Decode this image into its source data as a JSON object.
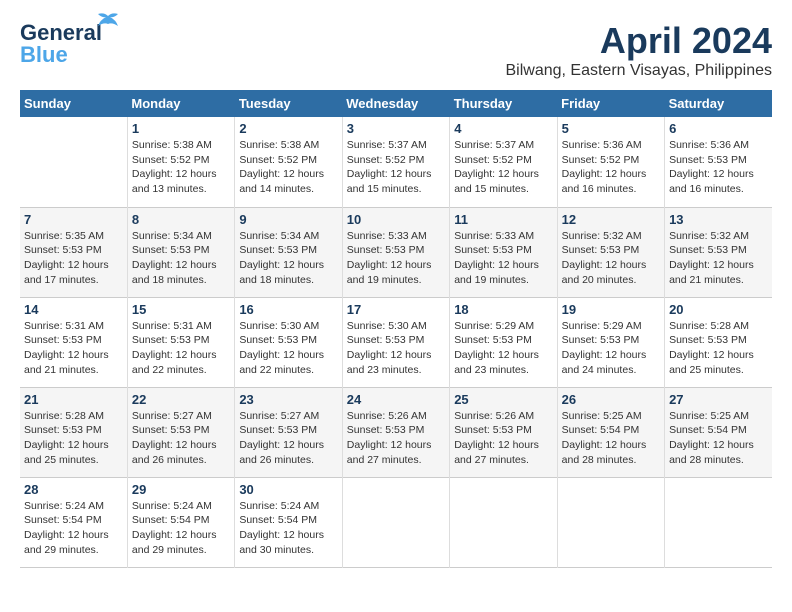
{
  "header": {
    "logo_line1": "General",
    "logo_line2": "Blue",
    "month_year": "April 2024",
    "location": "Bilwang, Eastern Visayas, Philippines"
  },
  "weekdays": [
    "Sunday",
    "Monday",
    "Tuesday",
    "Wednesday",
    "Thursday",
    "Friday",
    "Saturday"
  ],
  "weeks": [
    [
      {
        "day": "",
        "sunrise": "",
        "sunset": "",
        "daylight": ""
      },
      {
        "day": "1",
        "sunrise": "Sunrise: 5:38 AM",
        "sunset": "Sunset: 5:52 PM",
        "daylight": "Daylight: 12 hours and 13 minutes."
      },
      {
        "day": "2",
        "sunrise": "Sunrise: 5:38 AM",
        "sunset": "Sunset: 5:52 PM",
        "daylight": "Daylight: 12 hours and 14 minutes."
      },
      {
        "day": "3",
        "sunrise": "Sunrise: 5:37 AM",
        "sunset": "Sunset: 5:52 PM",
        "daylight": "Daylight: 12 hours and 15 minutes."
      },
      {
        "day": "4",
        "sunrise": "Sunrise: 5:37 AM",
        "sunset": "Sunset: 5:52 PM",
        "daylight": "Daylight: 12 hours and 15 minutes."
      },
      {
        "day": "5",
        "sunrise": "Sunrise: 5:36 AM",
        "sunset": "Sunset: 5:52 PM",
        "daylight": "Daylight: 12 hours and 16 minutes."
      },
      {
        "day": "6",
        "sunrise": "Sunrise: 5:36 AM",
        "sunset": "Sunset: 5:53 PM",
        "daylight": "Daylight: 12 hours and 16 minutes."
      }
    ],
    [
      {
        "day": "7",
        "sunrise": "Sunrise: 5:35 AM",
        "sunset": "Sunset: 5:53 PM",
        "daylight": "Daylight: 12 hours and 17 minutes."
      },
      {
        "day": "8",
        "sunrise": "Sunrise: 5:34 AM",
        "sunset": "Sunset: 5:53 PM",
        "daylight": "Daylight: 12 hours and 18 minutes."
      },
      {
        "day": "9",
        "sunrise": "Sunrise: 5:34 AM",
        "sunset": "Sunset: 5:53 PM",
        "daylight": "Daylight: 12 hours and 18 minutes."
      },
      {
        "day": "10",
        "sunrise": "Sunrise: 5:33 AM",
        "sunset": "Sunset: 5:53 PM",
        "daylight": "Daylight: 12 hours and 19 minutes."
      },
      {
        "day": "11",
        "sunrise": "Sunrise: 5:33 AM",
        "sunset": "Sunset: 5:53 PM",
        "daylight": "Daylight: 12 hours and 19 minutes."
      },
      {
        "day": "12",
        "sunrise": "Sunrise: 5:32 AM",
        "sunset": "Sunset: 5:53 PM",
        "daylight": "Daylight: 12 hours and 20 minutes."
      },
      {
        "day": "13",
        "sunrise": "Sunrise: 5:32 AM",
        "sunset": "Sunset: 5:53 PM",
        "daylight": "Daylight: 12 hours and 21 minutes."
      }
    ],
    [
      {
        "day": "14",
        "sunrise": "Sunrise: 5:31 AM",
        "sunset": "Sunset: 5:53 PM",
        "daylight": "Daylight: 12 hours and 21 minutes."
      },
      {
        "day": "15",
        "sunrise": "Sunrise: 5:31 AM",
        "sunset": "Sunset: 5:53 PM",
        "daylight": "Daylight: 12 hours and 22 minutes."
      },
      {
        "day": "16",
        "sunrise": "Sunrise: 5:30 AM",
        "sunset": "Sunset: 5:53 PM",
        "daylight": "Daylight: 12 hours and 22 minutes."
      },
      {
        "day": "17",
        "sunrise": "Sunrise: 5:30 AM",
        "sunset": "Sunset: 5:53 PM",
        "daylight": "Daylight: 12 hours and 23 minutes."
      },
      {
        "day": "18",
        "sunrise": "Sunrise: 5:29 AM",
        "sunset": "Sunset: 5:53 PM",
        "daylight": "Daylight: 12 hours and 23 minutes."
      },
      {
        "day": "19",
        "sunrise": "Sunrise: 5:29 AM",
        "sunset": "Sunset: 5:53 PM",
        "daylight": "Daylight: 12 hours and 24 minutes."
      },
      {
        "day": "20",
        "sunrise": "Sunrise: 5:28 AM",
        "sunset": "Sunset: 5:53 PM",
        "daylight": "Daylight: 12 hours and 25 minutes."
      }
    ],
    [
      {
        "day": "21",
        "sunrise": "Sunrise: 5:28 AM",
        "sunset": "Sunset: 5:53 PM",
        "daylight": "Daylight: 12 hours and 25 minutes."
      },
      {
        "day": "22",
        "sunrise": "Sunrise: 5:27 AM",
        "sunset": "Sunset: 5:53 PM",
        "daylight": "Daylight: 12 hours and 26 minutes."
      },
      {
        "day": "23",
        "sunrise": "Sunrise: 5:27 AM",
        "sunset": "Sunset: 5:53 PM",
        "daylight": "Daylight: 12 hours and 26 minutes."
      },
      {
        "day": "24",
        "sunrise": "Sunrise: 5:26 AM",
        "sunset": "Sunset: 5:53 PM",
        "daylight": "Daylight: 12 hours and 27 minutes."
      },
      {
        "day": "25",
        "sunrise": "Sunrise: 5:26 AM",
        "sunset": "Sunset: 5:53 PM",
        "daylight": "Daylight: 12 hours and 27 minutes."
      },
      {
        "day": "26",
        "sunrise": "Sunrise: 5:25 AM",
        "sunset": "Sunset: 5:54 PM",
        "daylight": "Daylight: 12 hours and 28 minutes."
      },
      {
        "day": "27",
        "sunrise": "Sunrise: 5:25 AM",
        "sunset": "Sunset: 5:54 PM",
        "daylight": "Daylight: 12 hours and 28 minutes."
      }
    ],
    [
      {
        "day": "28",
        "sunrise": "Sunrise: 5:24 AM",
        "sunset": "Sunset: 5:54 PM",
        "daylight": "Daylight: 12 hours and 29 minutes."
      },
      {
        "day": "29",
        "sunrise": "Sunrise: 5:24 AM",
        "sunset": "Sunset: 5:54 PM",
        "daylight": "Daylight: 12 hours and 29 minutes."
      },
      {
        "day": "30",
        "sunrise": "Sunrise: 5:24 AM",
        "sunset": "Sunset: 5:54 PM",
        "daylight": "Daylight: 12 hours and 30 minutes."
      },
      {
        "day": "",
        "sunrise": "",
        "sunset": "",
        "daylight": ""
      },
      {
        "day": "",
        "sunrise": "",
        "sunset": "",
        "daylight": ""
      },
      {
        "day": "",
        "sunrise": "",
        "sunset": "",
        "daylight": ""
      },
      {
        "day": "",
        "sunrise": "",
        "sunset": "",
        "daylight": ""
      }
    ]
  ]
}
